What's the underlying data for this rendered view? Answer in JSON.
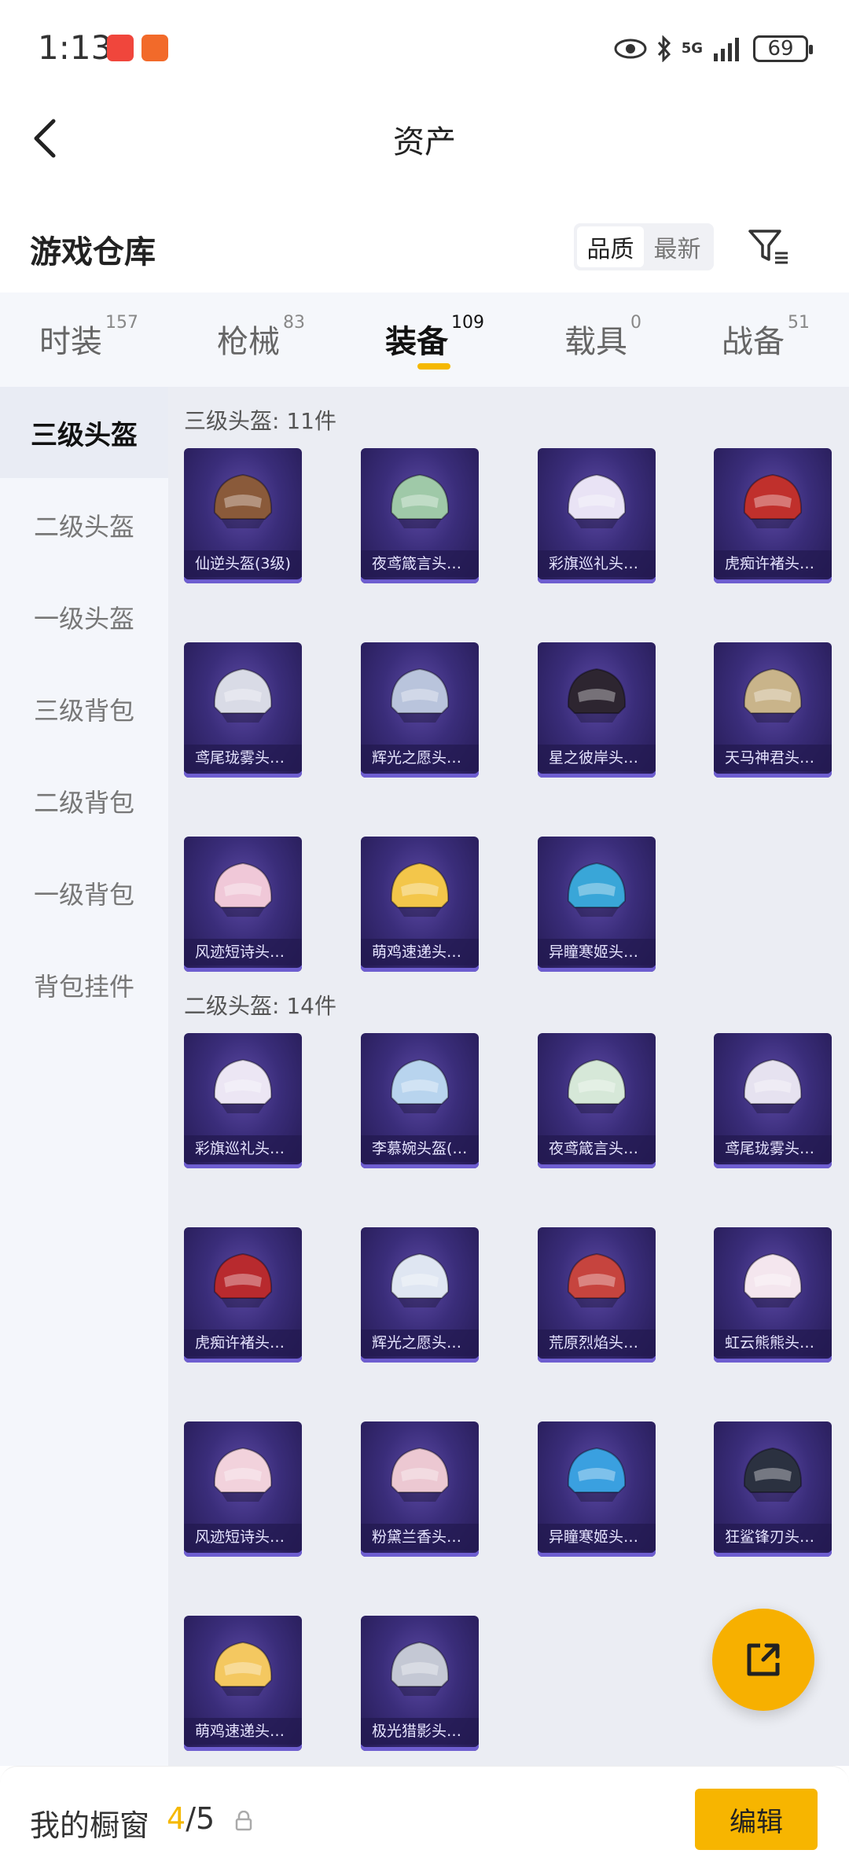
{
  "status_bar": {
    "time": "1:13",
    "battery": "69",
    "network": "5G"
  },
  "header": {
    "title": "资产"
  },
  "warehouse": {
    "title": "游戏仓库",
    "sort_options": [
      "品质",
      "最新"
    ],
    "active_sort": "品质"
  },
  "tabs": [
    {
      "label": "时装",
      "count": "157"
    },
    {
      "label": "枪械",
      "count": "83"
    },
    {
      "label": "装备",
      "count": "109",
      "active": true
    },
    {
      "label": "载具",
      "count": "0"
    },
    {
      "label": "战备",
      "count": "51"
    }
  ],
  "sidebar": {
    "items": [
      {
        "label": "三级头盔",
        "active": true
      },
      {
        "label": "二级头盔"
      },
      {
        "label": "一级头盔"
      },
      {
        "label": "三级背包"
      },
      {
        "label": "二级背包"
      },
      {
        "label": "一级背包"
      },
      {
        "label": "背包挂件"
      }
    ]
  },
  "sections": [
    {
      "title": "三级头盔: 11件",
      "items": [
        {
          "name": "仙逆头盔(3级)",
          "color": "#8a5a3a"
        },
        {
          "name": "夜鸢箴言头…",
          "color": "#9fc9a8"
        },
        {
          "name": "彩旗巡礼头…",
          "color": "#e9e3f5"
        },
        {
          "name": "虎痴许褚头…",
          "color": "#c0302c"
        },
        {
          "name": "鸢尾珑雾头…",
          "color": "#d9dbe6"
        },
        {
          "name": "辉光之愿头…",
          "color": "#b9c4dc"
        },
        {
          "name": "星之彼岸头…",
          "color": "#2d2530"
        },
        {
          "name": "天马神君头…",
          "color": "#c9b48a"
        },
        {
          "name": "风迹短诗头…",
          "color": "#f0c8d8"
        },
        {
          "name": "萌鸡速递头…",
          "color": "#f3c64a"
        },
        {
          "name": "异瞳寒姬头…",
          "color": "#39a6d8"
        }
      ]
    },
    {
      "title": "二级头盔: 14件",
      "items": [
        {
          "name": "彩旗巡礼头…",
          "color": "#ece6f4"
        },
        {
          "name": "李慕婉头盔(…",
          "color": "#b8d4ee"
        },
        {
          "name": "夜鸢箴言头…",
          "color": "#d6e8d8"
        },
        {
          "name": "鸢尾珑雾头…",
          "color": "#e6e2f0"
        },
        {
          "name": "虎痴许褚头…",
          "color": "#b82a2e"
        },
        {
          "name": "辉光之愿头…",
          "color": "#dfe6f2"
        },
        {
          "name": "荒原烈焰头…",
          "color": "#c6443e"
        },
        {
          "name": "虹云熊熊头…",
          "color": "#f4e6ee"
        },
        {
          "name": "风迹短诗头…",
          "color": "#f2d2dc"
        },
        {
          "name": "粉黛兰香头…",
          "color": "#ecc8d2"
        },
        {
          "name": "异瞳寒姬头…",
          "color": "#3aa0e0"
        },
        {
          "name": "狂鲨锋刃头…",
          "color": "#2b3140"
        },
        {
          "name": "萌鸡速递头…",
          "color": "#f4c860"
        },
        {
          "name": "极光猎影头…",
          "color": "#c4c8d4"
        }
      ]
    }
  ],
  "bottom": {
    "showcase_label": "我的橱窗",
    "showcase_current": "4",
    "showcase_total": "/5",
    "edit_label": "编辑"
  },
  "colors": {
    "accent": "#f5b800",
    "card_bg": "#3a2d7a"
  }
}
